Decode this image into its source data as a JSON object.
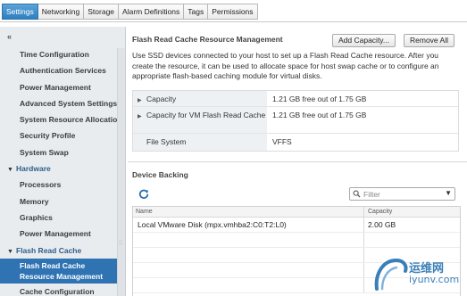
{
  "tabs": [
    {
      "label": "Settings",
      "active": true
    },
    {
      "label": "Networking",
      "active": false
    },
    {
      "label": "Storage",
      "active": false
    },
    {
      "label": "Alarm Definitions",
      "active": false
    },
    {
      "label": "Tags",
      "active": false
    },
    {
      "label": "Permissions",
      "active": false
    }
  ],
  "sidebar": {
    "collapse_glyph": "«",
    "items": [
      {
        "label": "Time Configuration"
      },
      {
        "label": "Authentication Services"
      },
      {
        "label": "Power Management"
      },
      {
        "label": "Advanced System Settings"
      },
      {
        "label": "System Resource Allocation"
      },
      {
        "label": "Security Profile"
      },
      {
        "label": "System Swap"
      }
    ],
    "hardware": {
      "label": "Hardware"
    },
    "hardware_items": [
      {
        "label": "Processors"
      },
      {
        "label": "Memory"
      },
      {
        "label": "Graphics"
      },
      {
        "label": "Power Management"
      }
    ],
    "flash": {
      "label": "Flash Read Cache"
    },
    "flash_items": [
      {
        "label": "Flash Read Cache Resource Management",
        "selected": true
      },
      {
        "label": "Cache Configuration"
      }
    ],
    "grip_glyph": "::"
  },
  "main": {
    "title": "Flash Read Cache Resource Management",
    "add_button": "Add Capacity...",
    "remove_button": "Remove All",
    "description": "Use SSD devices connected to your host to set up a Flash Read Cache resource. After you create the resource, it can be used to allocate space for host swap cache or to configure an appropriate flash-based caching module for virtual disks.",
    "properties": [
      {
        "key": "Capacity",
        "value": "1.21 GB free out of 1.75 GB",
        "expandable": true
      },
      {
        "key": "Capacity for VM Flash Read Cache",
        "value": "1.21 GB free out of 1.75 GB",
        "expandable": true
      },
      {
        "key": "File System",
        "value": "VFFS",
        "expandable": false
      }
    ],
    "device_backing": {
      "title": "Device Backing",
      "filter_placeholder": "Filter",
      "columns": [
        "Name",
        "Capacity"
      ],
      "rows": [
        {
          "name": "Local VMware Disk (mpx.vmhba2:C0:T2:L0)",
          "capacity": "2.00 GB"
        }
      ]
    }
  },
  "watermark": {
    "line1": "运维网",
    "line2": "iyunv.com"
  },
  "colors": {
    "accent": "#2f73b3",
    "section": "#2f5d8a",
    "sidebar_bg": "#e8ecef",
    "refresh": "#2a6fb0"
  }
}
